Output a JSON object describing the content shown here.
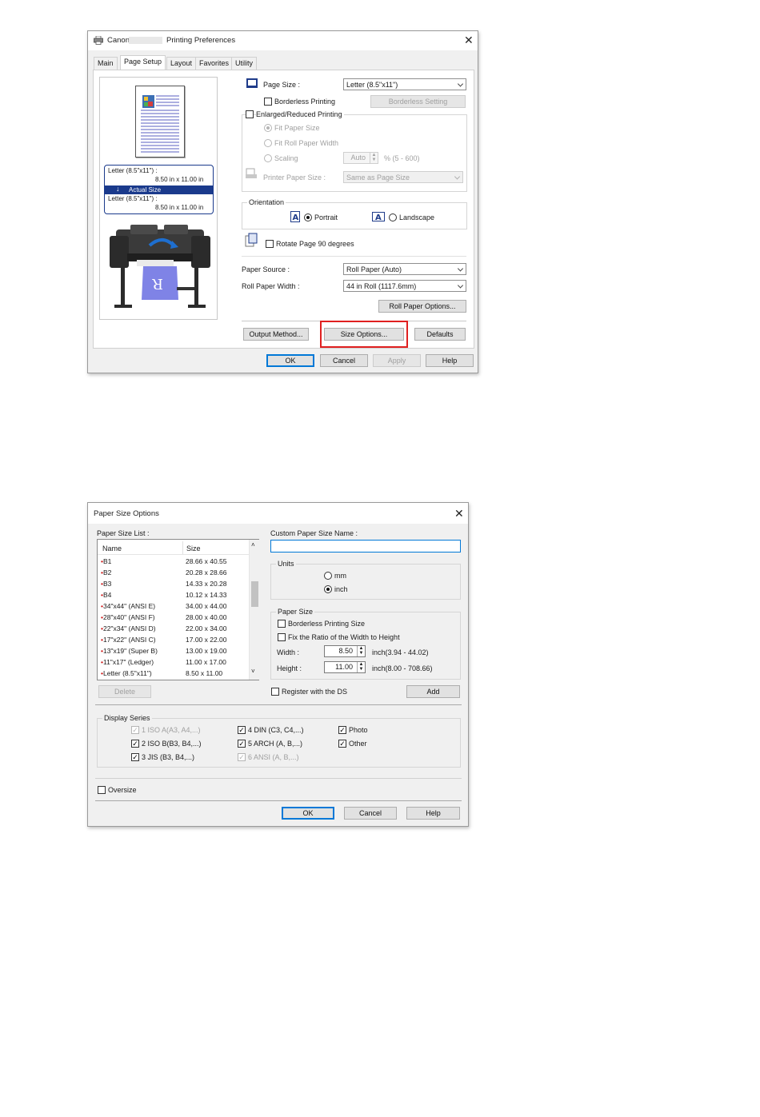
{
  "pref": {
    "title": "Canon",
    "title_suffix": "Printing Preferences",
    "tabs": [
      "Main",
      "Page Setup",
      "Layout",
      "Favorites",
      "Utility"
    ],
    "preview": {
      "size1_name": "Letter (8.5\"x11\") :",
      "size1_dim": "8.50 in x 11.00 in",
      "actual_size": "Actual Size",
      "size2_name": "Letter (8.5\"x11\") :",
      "size2_dim": "8.50 in x 11.00 in"
    },
    "page_size_label": "Page Size :",
    "page_size_value": "Letter (8.5\"x11\")",
    "borderless_printing": "Borderless Printing",
    "borderless_setting": "Borderless Setting",
    "enlarged_reduced": "Enlarged/Reduced Printing",
    "fit_paper_size": "Fit Paper Size",
    "fit_roll_paper_width": "Fit Roll Paper Width",
    "scaling": "Scaling",
    "scaling_value": "Auto",
    "scaling_range": "% (5 - 600)",
    "printer_paper_size_label": "Printer Paper Size :",
    "printer_paper_size_value": "Same as Page Size",
    "orientation": "Orientation",
    "portrait": "Portrait",
    "landscape": "Landscape",
    "rotate_page": "Rotate Page 90 degrees",
    "paper_source_label": "Paper Source :",
    "paper_source_value": "Roll Paper (Auto)",
    "roll_paper_width_label": "Roll Paper Width :",
    "roll_paper_width_value": "44 in Roll (1117.6mm)",
    "roll_paper_options": "Roll Paper Options...",
    "output_method": "Output Method...",
    "size_options": "Size Options...",
    "defaults": "Defaults",
    "ok": "OK",
    "cancel": "Cancel",
    "apply": "Apply",
    "help": "Help"
  },
  "pso": {
    "title": "Paper Size Options",
    "paper_size_list_label": "Paper Size List :",
    "col_name": "Name",
    "col_size": "Size",
    "rows": [
      {
        "name": "B1",
        "size": "28.66 x 40.55"
      },
      {
        "name": "B2",
        "size": "20.28 x 28.66"
      },
      {
        "name": "B3",
        "size": "14.33 x 20.28"
      },
      {
        "name": "B4",
        "size": "10.12 x 14.33"
      },
      {
        "name": "34\"x44\" (ANSI E)",
        "size": "34.00 x 44.00"
      },
      {
        "name": "28\"x40\" (ANSI F)",
        "size": "28.00 x 40.00"
      },
      {
        "name": "22\"x34\" (ANSI D)",
        "size": "22.00 x 34.00"
      },
      {
        "name": "17\"x22\" (ANSI C)",
        "size": "17.00 x 22.00"
      },
      {
        "name": "13\"x19\" (Super B)",
        "size": "13.00 x 19.00"
      },
      {
        "name": "11\"x17\" (Ledger)",
        "size": "11.00 x 17.00"
      },
      {
        "name": "Letter (8.5\"x11\")",
        "size": "8.50 x 11.00"
      }
    ],
    "delete": "Delete",
    "custom_name_label": "Custom Paper Size Name :",
    "custom_name_value": "",
    "units": "Units",
    "unit_mm": "mm",
    "unit_inch": "inch",
    "paper_size": "Paper Size",
    "borderless_printing_size": "Borderless Printing Size",
    "fix_ratio": "Fix the Ratio of the Width to Height",
    "width_label": "Width :",
    "width_value": "8.50",
    "width_range": "inch(3.94 - 44.02)",
    "height_label": "Height :",
    "height_value": "11.00",
    "height_range": "inch(8.00 - 708.66)",
    "register_ds": "Register with the DS",
    "add": "Add",
    "display_series": "Display Series",
    "series": {
      "iso_a": "1 ISO A(A3, A4,...)",
      "iso_b": "2 ISO B(B3, B4,...)",
      "jis": "3 JIS (B3, B4,...)",
      "din": "4 DIN (C3, C4,...)",
      "arch": "5 ARCH (A, B,...)",
      "ansi": "6 ANSI (A, B,...)",
      "photo": "Photo",
      "other": "Other"
    },
    "oversize": "Oversize",
    "ok": "OK",
    "cancel": "Cancel",
    "help": "Help"
  },
  "colors": {
    "highlight_box": "#e02020",
    "selection": "#1a3a8c",
    "preview_bg": "#ffffff"
  }
}
